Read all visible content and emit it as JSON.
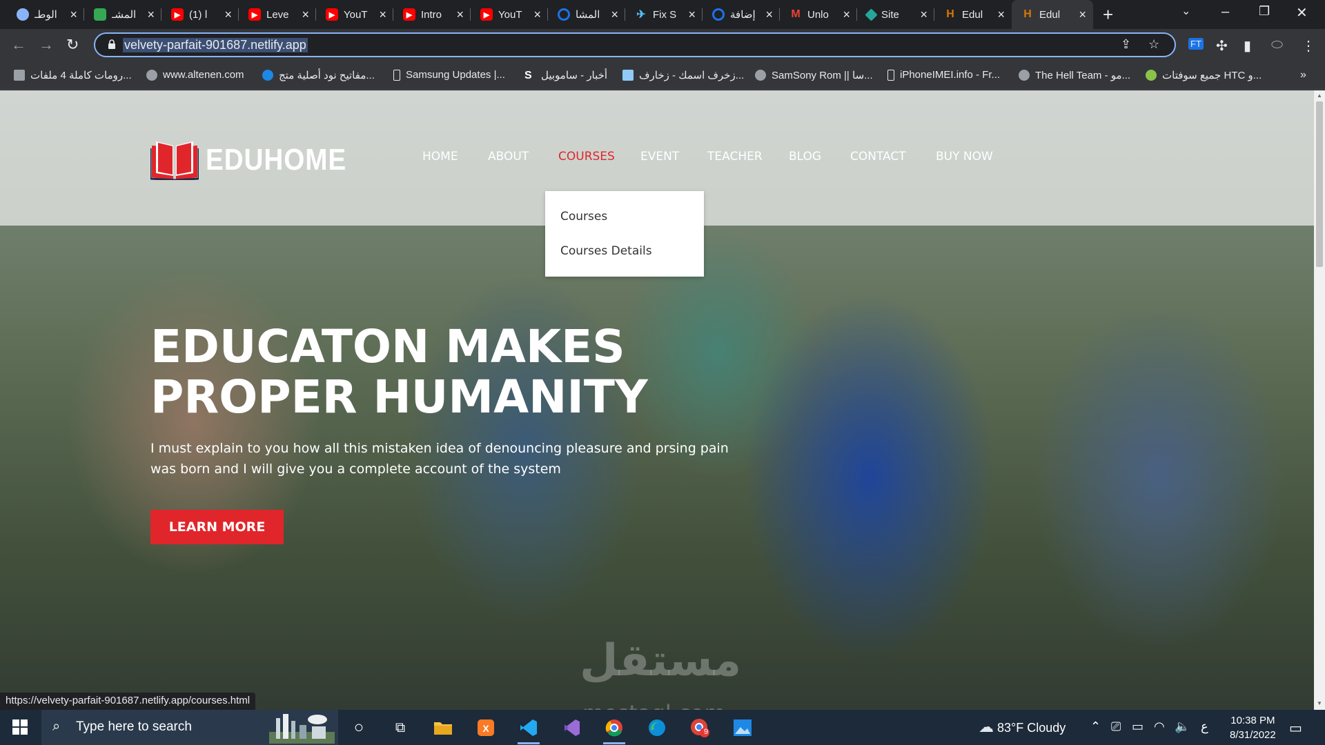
{
  "browser": {
    "tabs": [
      {
        "title": "الوطـ",
        "icon": "browser-circle-icon",
        "color": "#8ab4f8"
      },
      {
        "title": "المشـ",
        "icon": "green-app-icon",
        "color": "#34a853"
      },
      {
        "title": "(1) ا",
        "icon": "youtube-icon",
        "color": "#ff0000"
      },
      {
        "title": "Leve",
        "icon": "youtube-icon",
        "color": "#ff0000"
      },
      {
        "title": "YouT",
        "icon": "youtube-icon",
        "color": "#ff0000"
      },
      {
        "title": "Intro",
        "icon": "youtube-icon",
        "color": "#ff0000"
      },
      {
        "title": "YouT",
        "icon": "youtube-icon",
        "color": "#ff0000"
      },
      {
        "title": "المشا",
        "icon": "blue-ring-icon",
        "color": "#1a73e8"
      },
      {
        "title": "Fix S",
        "icon": "bird-icon",
        "color": "#4fc3f7"
      },
      {
        "title": "إضافة",
        "icon": "blue-ring-icon",
        "color": "#1a73e8"
      },
      {
        "title": "Unlo",
        "icon": "gmail-icon",
        "color": "#ea4335"
      },
      {
        "title": "Site",
        "icon": "diamond-icon",
        "color": "#26a69a"
      },
      {
        "title": "Edul",
        "icon": "eduhome-favicon-icon",
        "color": "#d97706"
      },
      {
        "title": "Edul",
        "icon": "eduhome-favicon-icon",
        "color": "#d97706",
        "active": true
      }
    ],
    "url": "velvety-parfait-901687.netlify.app",
    "status_url": "https://velvety-parfait-901687.netlify.app/courses.html",
    "bookmarks": [
      "رومات كاملة 4 ملفات...",
      "www.altenen.com",
      "مفاتيح نود أصلية متج...",
      "Samsung Updates |...",
      "أخبار - ساموبيل",
      "زخرف اسمك - زخارف...",
      "SamSony Rom || سا...",
      "iPhoneIMEI.info - Fr...",
      "The Hell Team - مو...",
      "جميع سوفتات HTC و..."
    ]
  },
  "site": {
    "logo_text": "EDUHOME",
    "nav": [
      "HOME",
      "ABOUT",
      "COURSES",
      "EVENT",
      "TEACHER",
      "BLOG",
      "CONTACT",
      "BUY NOW"
    ],
    "active_nav": "COURSES",
    "dropdown": [
      "Courses",
      "Courses Details"
    ],
    "hero": {
      "line1": "EDUCATON MAKES",
      "line2": "PROPER HUMANITY",
      "text_line1": "I must explain to you how all this mistaken idea of denouncing pleasure and prsing pain",
      "text_line2": "was born and I will give you a complete account of the system",
      "cta": "LEARN MORE"
    },
    "watermark": {
      "arabic": "مستقل",
      "latin": "mostaql.com"
    },
    "accent": "#e0262b"
  },
  "taskbar": {
    "search_placeholder": "Type here to search",
    "weather": "83°F  Cloudy",
    "lang": "ع",
    "time": "10:38 PM",
    "date": "8/31/2022",
    "badge": "9"
  }
}
